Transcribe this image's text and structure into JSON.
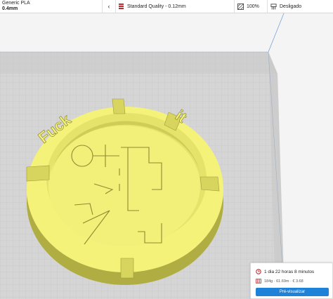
{
  "header": {
    "material_name": "Generic PLA",
    "nozzle": "0.4mm",
    "chevron": "‹",
    "quality_label": "Standard Quality - 0.12mm",
    "infill_value": "100%",
    "support_label": "Desligado"
  },
  "model": {
    "embossed_text_left": "Fuck",
    "embossed_text_right": "it",
    "color": "#f5f27a"
  },
  "print_panel": {
    "time": "1 dia 22 horas 8 minutos",
    "stats": "184g · 61.69m · € 3.68",
    "preview_button": "Pré-visualizar"
  },
  "colors": {
    "accent": "#1e83d8",
    "quality_icon": "#c2282d",
    "time_icon": "#c2282d",
    "plate": "#d4d4d4",
    "grid_line": "#c2c2c2"
  }
}
